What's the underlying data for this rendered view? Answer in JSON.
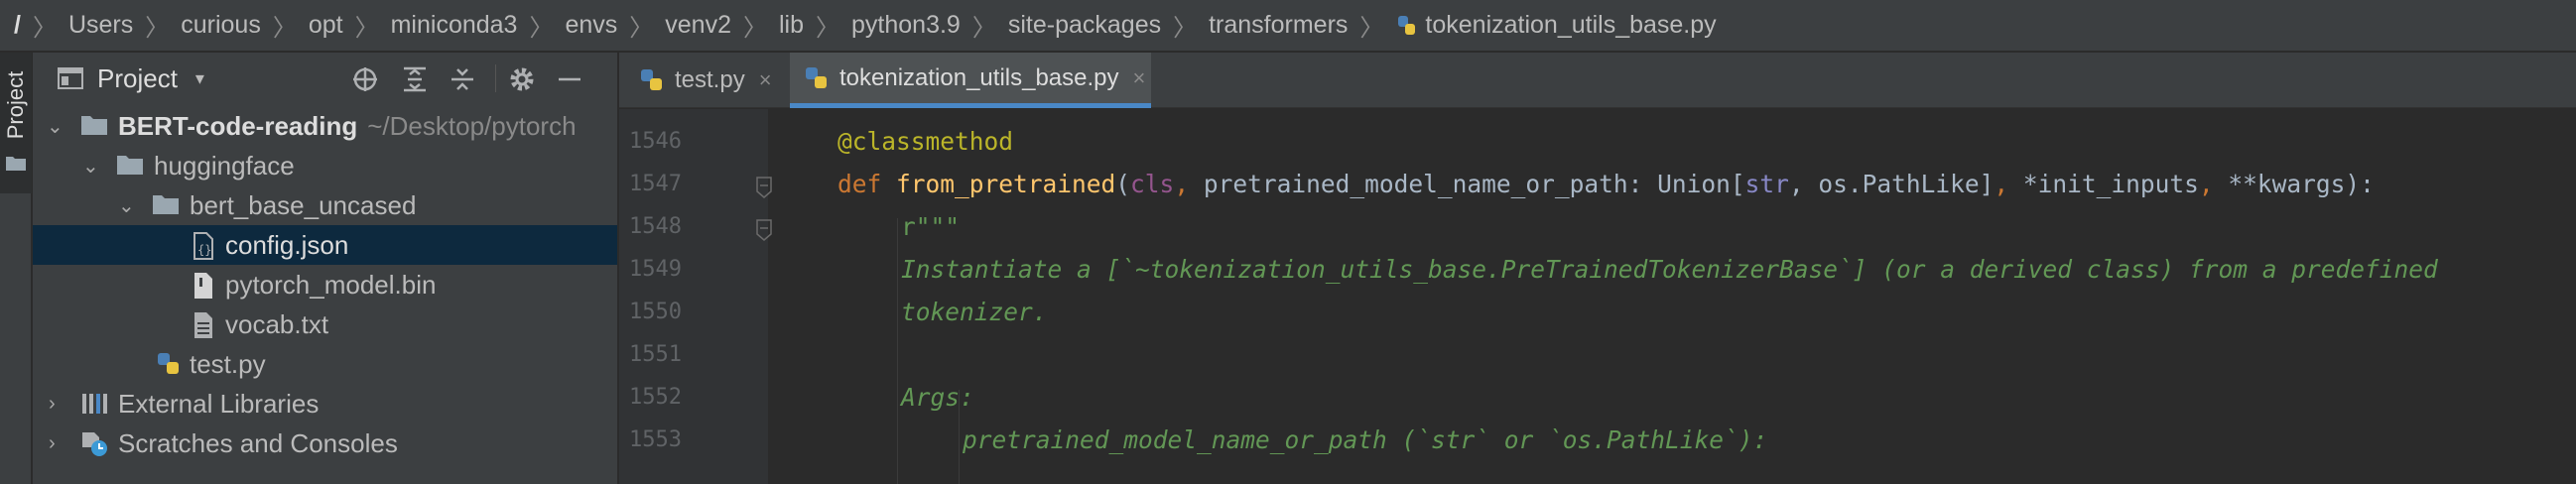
{
  "breadcrumb": {
    "root": "/",
    "items": [
      "Users",
      "curious",
      "opt",
      "miniconda3",
      "envs",
      "venv2",
      "lib",
      "python3.9",
      "site-packages",
      "transformers",
      "tokenization_utils_base.py"
    ],
    "separator": "〉"
  },
  "tool_stripe": {
    "project_label": "Project"
  },
  "project_panel": {
    "title": "Project",
    "caret": "▾",
    "tree": [
      {
        "label": "BERT-code-reading",
        "hint": "~/Desktop/pytorch",
        "icon": "folder-icon",
        "expanded": true
      },
      {
        "label": "huggingface",
        "icon": "folder-icon",
        "expanded": true
      },
      {
        "label": "bert_base_uncased",
        "icon": "folder-icon",
        "expanded": true
      },
      {
        "label": "config.json",
        "icon": "json-file-icon",
        "selected": true
      },
      {
        "label": "pytorch_model.bin",
        "icon": "binary-file-icon"
      },
      {
        "label": "vocab.txt",
        "icon": "text-file-icon"
      },
      {
        "label": "test.py",
        "icon": "python-file-icon"
      },
      {
        "label": "External Libraries",
        "icon": "libraries-icon",
        "expanded": false
      },
      {
        "label": "Scratches and Consoles",
        "icon": "scratches-icon",
        "expanded": false
      }
    ]
  },
  "tabs": [
    {
      "label": "test.py",
      "close": "×",
      "active": false
    },
    {
      "label": "tokenization_utils_base.py",
      "close": "×",
      "active": true
    }
  ],
  "editor": {
    "line_numbers": [
      "1546",
      "1547",
      "1548",
      "1549",
      "1550",
      "1551",
      "1552",
      "1553"
    ],
    "code": {
      "l1546_decorator": "@classmethod",
      "l1547_def": "def ",
      "l1547_fn": "from_pretrained",
      "l1547_open": "(",
      "l1547_cls": "cls",
      "l1547_comma1": ", ",
      "l1547_param": "pretrained_model_name_or_path: Union[",
      "l1547_str": "str",
      "l1547_rest1": ", os.PathLike]",
      "l1547_comma2": ", ",
      "l1547_args": "*init_inputs",
      "l1547_comma3": ", ",
      "l1547_kwargs": "**kwargs):",
      "l1548": "r\"\"\"",
      "l1549": "Instantiate a [`~tokenization_utils_base.PreTrainedTokenizerBase`] (or a derived class) from a predefined",
      "l1550": "tokenizer.",
      "l1551": "",
      "l1552": "Args:",
      "l1553": "pretrained_model_name_or_path (`str` or `os.PathLike`):"
    }
  },
  "colors": {
    "background": "#2b2b2b",
    "panel": "#3c3f41",
    "selection": "#0d293e",
    "tab_underline": "#4a88c7",
    "keyword": "#cc7832",
    "function": "#ffc66d",
    "docstring": "#629755",
    "decorator": "#bbb529"
  }
}
